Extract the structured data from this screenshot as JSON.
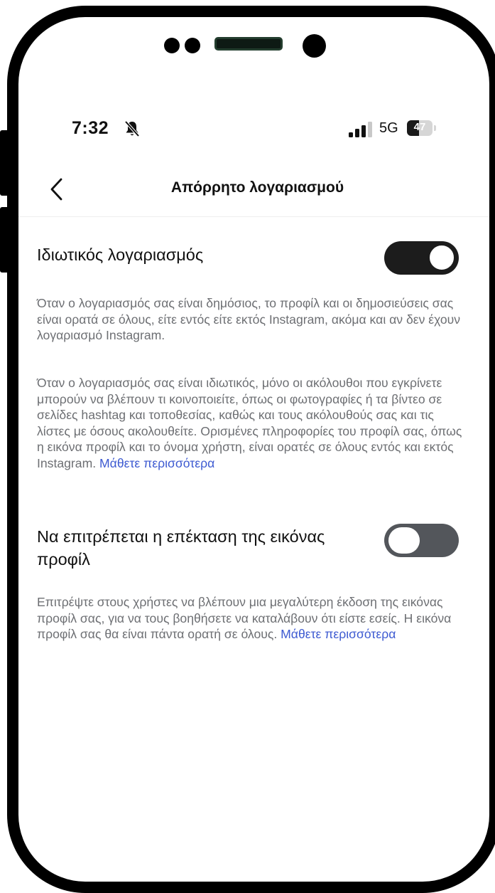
{
  "status_bar": {
    "time": "7:32",
    "network": "5G",
    "battery": "47",
    "battery_level": 0.47,
    "icons": [
      "bell-muted-icon",
      "signal-icon",
      "battery-icon"
    ]
  },
  "header": {
    "back_icon": "chevron-left-icon",
    "title": "Απόρρητο λογαριασμού"
  },
  "private_account": {
    "label": "Ιδιωτικός λογαριασμός",
    "enabled": true,
    "desc_public": "Όταν ο λογαριασμός σας είναι δημόσιος, το προφίλ και οι δημοσιεύσεις σας είναι ορατά σε όλους, είτε εντός είτε εκτός Instagram, ακόμα και αν δεν έχουν λογαριασμό Instagram.",
    "desc_private": "Όταν ο λογαριασμός σας είναι ιδιωτικός, μόνο οι ακόλουθοι που εγκρίνετε μπορούν να βλέπουν τι κοινοποιείτε, όπως οι φωτογραφίες ή τα βίντεο σε σελίδες hashtag και τοποθεσίας, καθώς και τους ακόλουθούς σας και τις λίστες με όσους ακολουθείτε. Ορισμένες πληροφορίες του προφίλ σας, όπως η εικόνα προφίλ και το όνομα χρήστη, είναι ορατές σε όλους εντός και εκτός Instagram.",
    "learn_more": "Μάθετε περισσότερα"
  },
  "profile_picture_expand": {
    "label": "Να επιτρέπεται η επέκταση της εικόνας προφίλ",
    "enabled": false,
    "desc": "Επιτρέψτε στους χρήστες να βλέπουν μια μεγαλύτερη έκδοση της εικόνας προφίλ σας, για να τους βοηθήσετε να καταλάβουν ότι είστε εσείς. Η εικόνα προφίλ σας θα είναι πάντα ορατή σε όλους.",
    "learn_more": "Μάθετε περισσότερα"
  },
  "colors": {
    "link": "#3d5ad1",
    "toggle_on": "#1c1c1c",
    "toggle_off": "#53565b",
    "desc_text": "#6d6f73"
  }
}
